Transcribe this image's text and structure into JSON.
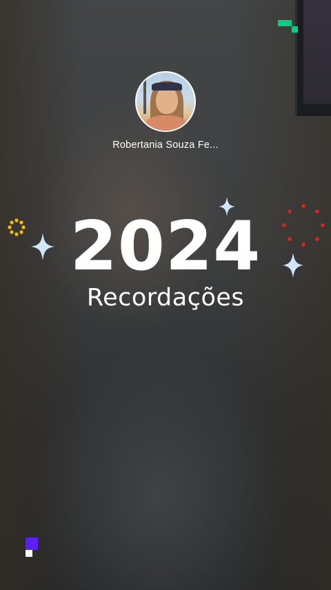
{
  "profile": {
    "name": "Robertania Souza Fe..."
  },
  "recap": {
    "year": "2024",
    "subtitle": "Recordações"
  },
  "colors": {
    "sparkle": "#cfe6ff",
    "sun_ring": "#f2c000",
    "red_dots": "#d9261c",
    "green_pixel": "#00d084",
    "purple_pixel": "#5b1fff"
  },
  "icons": [
    "sparkle-icon",
    "sun-ring-icon",
    "dotted-circle-icon",
    "pixel-blocks-icon"
  ]
}
